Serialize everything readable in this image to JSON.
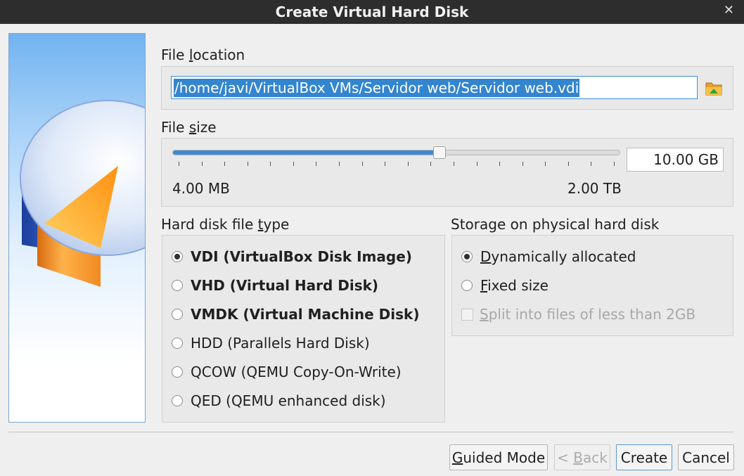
{
  "window": {
    "title": "Create Virtual Hard Disk",
    "close_glyph": "✕"
  },
  "file_location": {
    "label_pre": "File ",
    "label_u": "l",
    "label_post": "ocation",
    "value": "/home/javi/VirtualBox VMs/Servidor web/Servidor web.vdi",
    "browse_icon": "folder-icon"
  },
  "file_size": {
    "label_pre": "File ",
    "label_u": "s",
    "label_post": "ize",
    "value": "10.00 GB",
    "min_label": "4.00 MB",
    "max_label": "2.00 TB",
    "slider_fraction": 0.6
  },
  "disk_type": {
    "label_pre": "Hard disk file ",
    "label_u": "t",
    "label_post": "ype",
    "options": [
      {
        "label": "VDI (VirtualBox Disk Image)",
        "selected": true,
        "bold": true
      },
      {
        "label": "VHD (Virtual Hard Disk)",
        "selected": false,
        "bold": true
      },
      {
        "label": "VMDK (Virtual Machine Disk)",
        "selected": false,
        "bold": true
      },
      {
        "label": "HDD (Parallels Hard Disk)",
        "selected": false,
        "bold": false
      },
      {
        "label": "QCOW (QEMU Copy-On-Write)",
        "selected": false,
        "bold": false
      },
      {
        "label": "QED (QEMU enhanced disk)",
        "selected": false,
        "bold": false
      }
    ]
  },
  "storage": {
    "label": "Storage on physical hard disk",
    "dynamic_u": "D",
    "dynamic_rest": "ynamically allocated",
    "fixed_u": "F",
    "fixed_rest": "ixed size",
    "split_u": "S",
    "split_rest": "plit into files of less than 2GB"
  },
  "buttons": {
    "guided_u": "G",
    "guided_rest": "uided Mode",
    "back_pre": "< ",
    "back_u": "B",
    "back_rest": "ack",
    "create": "Create",
    "cancel": "Cancel"
  }
}
